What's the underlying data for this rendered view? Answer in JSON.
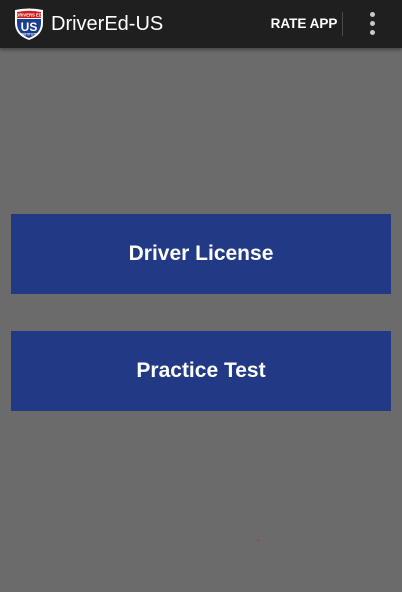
{
  "app": {
    "title": "DriverEd-US",
    "logo": {
      "top_text": "DRIVERS ED",
      "main_text": "US",
      "bottom_text": "INSTITUTE",
      "colors": {
        "shield_blue": "#1b3f8f",
        "shield_red": "#c81e1e",
        "outline": "#ffffff"
      }
    }
  },
  "toolbar": {
    "rate_label": "RATE APP",
    "overflow_icon": "more-vert-icon"
  },
  "main": {
    "buttons": [
      {
        "label": "Driver License"
      },
      {
        "label": "Practice Test"
      }
    ]
  },
  "colors": {
    "appbar": "#1f1f1f",
    "background": "#6b6b6b",
    "button": "#223a86",
    "button_text": "#ffffff"
  }
}
